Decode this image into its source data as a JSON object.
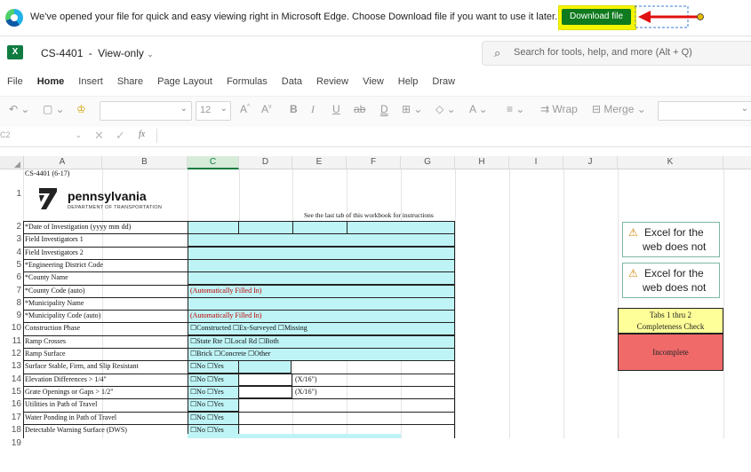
{
  "banner": {
    "message": "We've opened your file for quick and easy viewing right in Microsoft Edge. Choose Download file if you want to use it later.",
    "download_label": "Download file"
  },
  "title": {
    "app_icon": "X",
    "file_name": "CS-4401",
    "mode": "View-only",
    "separator": "-",
    "search_placeholder": "Search for tools, help, and more (Alt + Q)"
  },
  "ribbon": {
    "tabs": [
      "File",
      "Home",
      "Insert",
      "Share",
      "Page Layout",
      "Formulas",
      "Data",
      "Review",
      "View",
      "Help",
      "Draw"
    ],
    "active_tab": "Home",
    "font_size": "12",
    "wrap_label": "Wrap",
    "merge_label": "Merge"
  },
  "formula_bar": {
    "cell_ref": "C2",
    "fx_label": "fx"
  },
  "columns": [
    "A",
    "B",
    "C",
    "D",
    "E",
    "F",
    "G",
    "H",
    "I",
    "J",
    "K"
  ],
  "selected_column": "C",
  "sheet": {
    "form_id": "CS-4401 (6-17)",
    "logo_text": "pennsylvania",
    "logo_subtext": "DEPARTMENT OF TRANSPORTATION",
    "instruction_note": "See the last tab of this workbook for instructions",
    "rows": [
      {
        "num": "1",
        "label": "",
        "value": ""
      },
      {
        "num": "2",
        "label": "*Date of Investigation (yyyy mm dd)",
        "value": ""
      },
      {
        "num": "3",
        "label": "Field Investigators 1",
        "value": ""
      },
      {
        "num": "4",
        "label": "Field Investigators 2",
        "value": ""
      },
      {
        "num": "5",
        "label": "*Engineering District Code",
        "value": ""
      },
      {
        "num": "6",
        "label": "*County Name",
        "value": ""
      },
      {
        "num": "7",
        "label": "*County Code (auto)",
        "value": "(Automatically Filled In)"
      },
      {
        "num": "8",
        "label": "*Municipality Name",
        "value": ""
      },
      {
        "num": "9",
        "label": "*Municipality Code (auto)",
        "value": "(Automatically Filled In)"
      },
      {
        "num": "10",
        "label": "Construction Phase",
        "value": "☐Constructed   ☐Ex-Surveyed  ☐Missing"
      },
      {
        "num": "11",
        "label": "Ramp Crosses",
        "value": "☐State Rte  ☐Local Rd   ☐Both"
      },
      {
        "num": "12",
        "label": "Ramp Surface",
        "value": "☐Brick ☐Concrete ☐Other"
      },
      {
        "num": "13",
        "label": "Surface Stable, Firm, and Slip Resistant",
        "value": "☐No  ☐Yes"
      },
      {
        "num": "14",
        "label": "Elevation Differences > 1/4\"",
        "value": "☐No  ☐Yes",
        "extra": "(X/16\")"
      },
      {
        "num": "15",
        "label": "Grate Openings or Gaps > 1/2\"",
        "value": "☐No  ☐Yes",
        "extra": "(X/16\")"
      },
      {
        "num": "16",
        "label": "Utilities in Path of Travel",
        "value": "☐No  ☐Yes"
      },
      {
        "num": "17",
        "label": "Water Ponding in Path of Travel",
        "value": "☐No  ☐Yes"
      },
      {
        "num": "18",
        "label": "Detectable Warning Surface (DWS)",
        "value": "☐No  ☐Yes"
      }
    ],
    "warnings": [
      {
        "line1": "Excel for the",
        "line2": "web does not"
      },
      {
        "line1": "Excel for the",
        "line2": "web does not"
      }
    ],
    "completeness_header_1": "Tabs 1 thru 2",
    "completeness_header_2": "Completeness Check",
    "completeness_status": "Incomplete",
    "colors": {
      "cyan": "#bff4f6",
      "yellow": "#ffff99",
      "status_red": "#f06a6a",
      "excel_green": "#107c41"
    }
  }
}
